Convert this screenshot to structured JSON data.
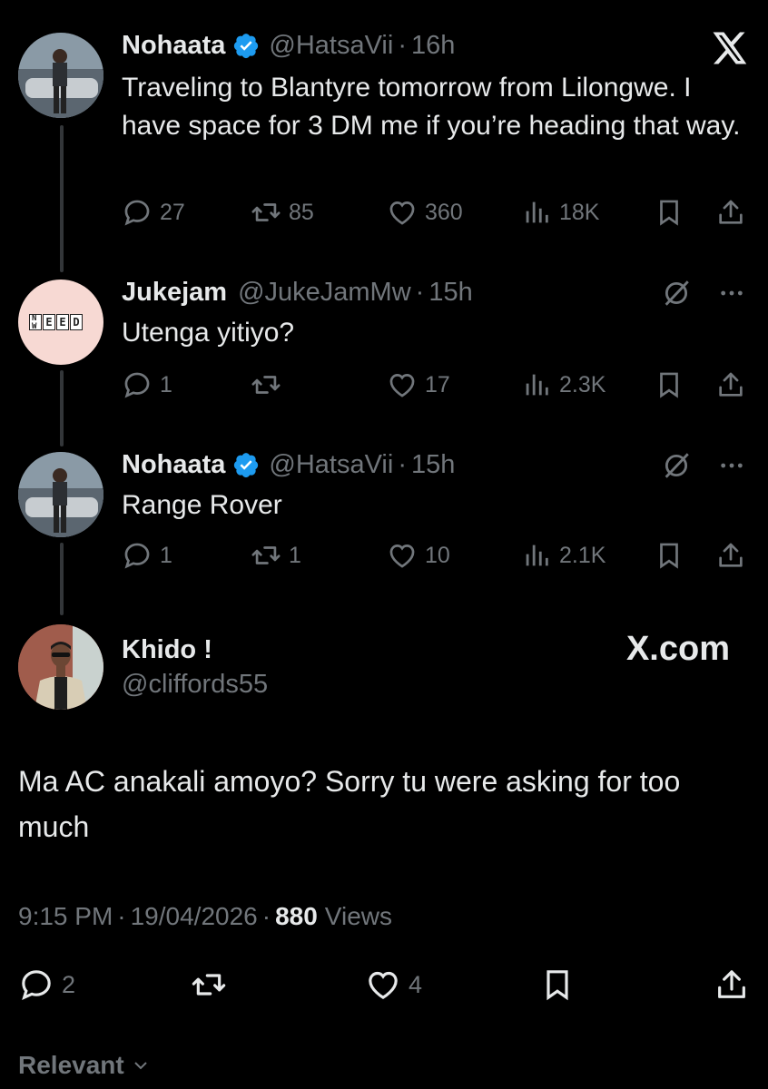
{
  "thread": [
    {
      "name": "Nohaata",
      "verified": true,
      "handle": "@HatsaVii",
      "time": "16h",
      "text": "Traveling to Blantyre tomorrow from Lilongwe. I have space for 3 DM me if you’re heading that way.",
      "replies": "27",
      "reposts": "85",
      "likes": "360",
      "views": "18K"
    },
    {
      "name": "Jukejam",
      "verified": false,
      "handle": "@JukeJamMw",
      "time": "15h",
      "text": "Utenga yitiyo?",
      "avatar_letters": [
        "N",
        "E",
        "E",
        "D",
        "W"
      ],
      "replies": "1",
      "reposts": "",
      "likes": "17",
      "views": "2.3K"
    },
    {
      "name": "Nohaata",
      "verified": true,
      "handle": "@HatsaVii",
      "time": "15h",
      "text": "Range Rover",
      "replies": "1",
      "reposts": "1",
      "likes": "10",
      "views": "2.1K"
    }
  ],
  "main": {
    "name": "Khido !",
    "handle": "@cliffords55",
    "watermark": "X.com",
    "text": "Ma AC anakali amoyo? Sorry tu were asking for too much",
    "time": "9:15 PM",
    "date": "19/04/2026",
    "views_count": "880",
    "views_label": "Views",
    "replies": "2",
    "reposts": "",
    "likes": "4"
  },
  "sort_label": "Relevant",
  "separator": "·",
  "colors": {
    "background": "#000000",
    "text": "#e7e9ea",
    "muted": "#71767b",
    "verified": "#1d9bf0",
    "thread_line": "#333639"
  }
}
